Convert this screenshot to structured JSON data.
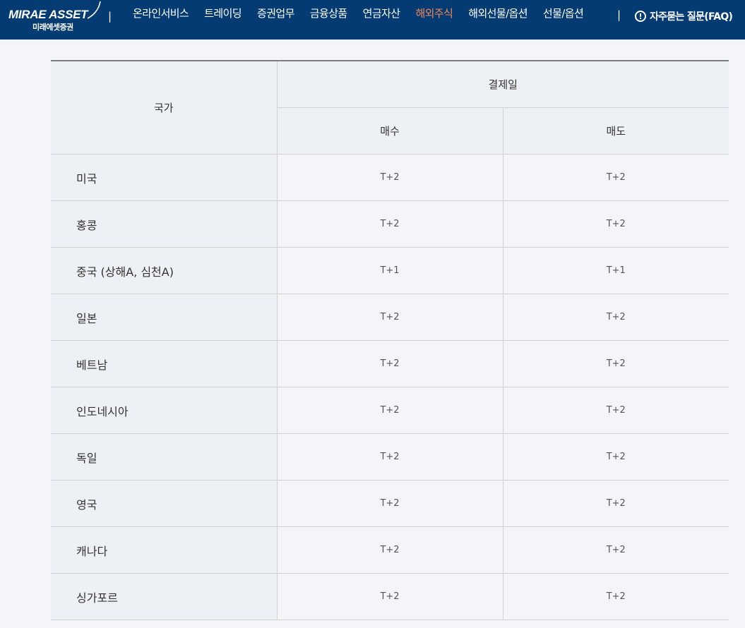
{
  "header": {
    "logo_text": "MIRAE ASSET",
    "logo_sub": "미래에셋증권",
    "nav": [
      {
        "label": "온라인서비스",
        "active": false
      },
      {
        "label": "트레이딩",
        "active": false
      },
      {
        "label": "증권업무",
        "active": false
      },
      {
        "label": "금융상품",
        "active": false
      },
      {
        "label": "연금자산",
        "active": false
      },
      {
        "label": "해외주식",
        "active": true
      },
      {
        "label": "해외선물/옵션",
        "active": false
      },
      {
        "label": "선물/옵션",
        "active": false
      }
    ],
    "separator": "|",
    "faq_icon": "!",
    "faq_label": "자주묻는 질문(FAQ)"
  },
  "colors": {
    "header_bg": "#043b72",
    "active_nav": "#f28a5c",
    "page_bg": "#f4f5f8",
    "header_cell_bg": "#edf0f4"
  },
  "table": {
    "country_header": "국가",
    "settlement_header": "결제일",
    "buy_header": "매수",
    "sell_header": "매도",
    "rows": [
      {
        "country": "미국",
        "buy": "T+2",
        "sell": "T+2"
      },
      {
        "country": "홍콩",
        "buy": "T+2",
        "sell": "T+2"
      },
      {
        "country": "중국 (상해A, 심천A)",
        "buy": "T+1",
        "sell": "T+1"
      },
      {
        "country": "일본",
        "buy": "T+2",
        "sell": "T+2"
      },
      {
        "country": "베트남",
        "buy": "T+2",
        "sell": "T+2"
      },
      {
        "country": "인도네시아",
        "buy": "T+2",
        "sell": "T+2"
      },
      {
        "country": "독일",
        "buy": "T+2",
        "sell": "T+2"
      },
      {
        "country": "영국",
        "buy": "T+2",
        "sell": "T+2"
      },
      {
        "country": "캐나다",
        "buy": "T+2",
        "sell": "T+2"
      },
      {
        "country": "싱가포르",
        "buy": "T+2",
        "sell": "T+2"
      }
    ]
  }
}
